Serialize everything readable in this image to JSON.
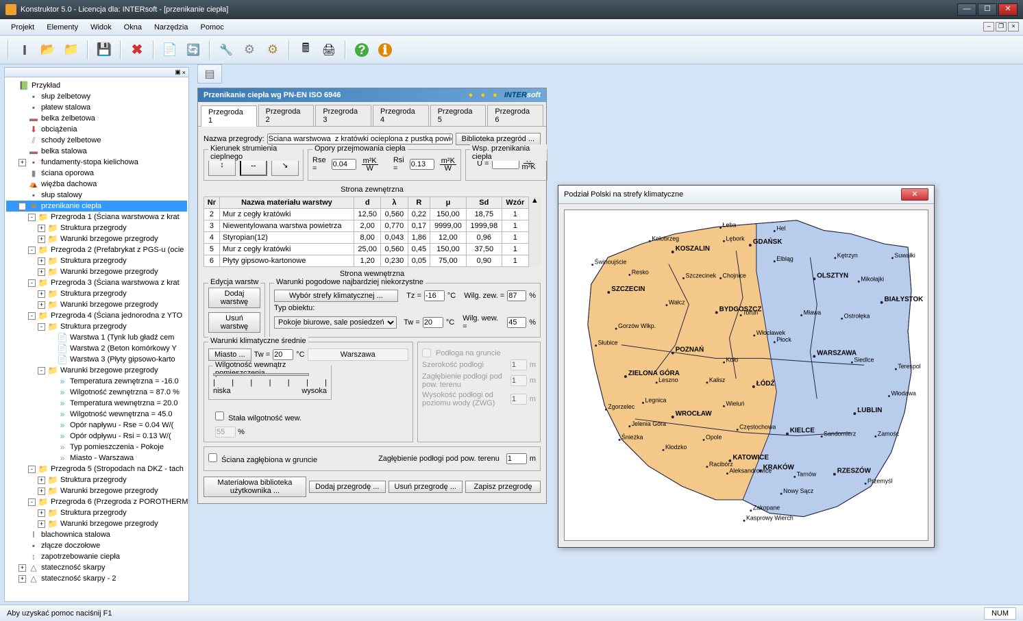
{
  "window": {
    "title": "Konstruktor 5.0 - Licencja dla: INTERsoft - [przenikanie ciepła]"
  },
  "menu": {
    "items": [
      "Projekt",
      "Elementy",
      "Widok",
      "Okna",
      "Narzędzia",
      "Pomoc"
    ]
  },
  "status": {
    "hint": "Aby uzyskać pomoc naciśnij F1",
    "num": "NUM"
  },
  "tree": {
    "root": "Przykład",
    "items": [
      {
        "l": 1,
        "ic": "item",
        "t": "słup żelbetowy"
      },
      {
        "l": 1,
        "ic": "item",
        "t": "płatew stalowa"
      },
      {
        "l": 1,
        "ic": "beam",
        "t": "belka żelbetowa"
      },
      {
        "l": 1,
        "ic": "load",
        "t": "obciążenia"
      },
      {
        "l": 1,
        "ic": "stair",
        "t": "schody żelbetowe"
      },
      {
        "l": 1,
        "ic": "beam",
        "t": "belka stalowa"
      },
      {
        "l": 1,
        "ic": "item",
        "t": "fundamenty-stopa kielichowa",
        "exp": "+"
      },
      {
        "l": 1,
        "ic": "wall",
        "t": "ściana oporowa"
      },
      {
        "l": 1,
        "ic": "roof",
        "t": "więźba dachowa"
      },
      {
        "l": 1,
        "ic": "item",
        "t": "słup stalowy"
      },
      {
        "l": 1,
        "ic": "heat",
        "t": "przenikanie ciepła",
        "exp": "-",
        "sel": true
      },
      {
        "l": 2,
        "ic": "fold",
        "t": "Przegroda 1 (Ściana warstwowa  z krat",
        "exp": "-"
      },
      {
        "l": 3,
        "ic": "struct",
        "t": "Struktura przegrody",
        "exp": "+"
      },
      {
        "l": 3,
        "ic": "struct",
        "t": "Warunki brzegowe przegrody",
        "exp": "+"
      },
      {
        "l": 2,
        "ic": "fold",
        "t": "Przegroda 2 (Prefabrykat z PGS-u (ocie",
        "exp": "-"
      },
      {
        "l": 3,
        "ic": "struct",
        "t": "Struktura przegrody",
        "exp": "+"
      },
      {
        "l": 3,
        "ic": "struct",
        "t": "Warunki brzegowe przegrody",
        "exp": "+"
      },
      {
        "l": 2,
        "ic": "fold",
        "t": "Przegroda 3 (Ściana warstwowa z krat",
        "exp": "-"
      },
      {
        "l": 3,
        "ic": "struct",
        "t": "Struktura przegrody",
        "exp": "+"
      },
      {
        "l": 3,
        "ic": "struct",
        "t": "Warunki brzegowe przegrody",
        "exp": "+"
      },
      {
        "l": 2,
        "ic": "fold",
        "t": "Przegroda 4 (Ściana jednorodna z YTO",
        "exp": "-"
      },
      {
        "l": 3,
        "ic": "fold",
        "t": "Struktura przegrody",
        "exp": "-"
      },
      {
        "l": 4,
        "ic": "layer",
        "t": "Warstwa 1 (Tynk lub gładź cem"
      },
      {
        "l": 4,
        "ic": "layer",
        "t": "Warstwa 2 (Beton komórkowy Y"
      },
      {
        "l": 4,
        "ic": "layer",
        "t": "Warstwa 3 (Płyty gipsowo-karto"
      },
      {
        "l": 3,
        "ic": "fold",
        "t": "Warunki brzegowe przegrody",
        "exp": "-"
      },
      {
        "l": 4,
        "ic": "val",
        "t": "Temperatura zewnętrzna = -16.0"
      },
      {
        "l": 4,
        "ic": "val",
        "t": "Wilgotność zewnętrzna = 87.0 %"
      },
      {
        "l": 4,
        "ic": "val",
        "t": "Temperatura wewnętrzna = 20.0"
      },
      {
        "l": 4,
        "ic": "val",
        "t": "Wilgotność wewnętrzna = 45.0"
      },
      {
        "l": 4,
        "ic": "val",
        "t": "Opór napływu - Rse = 0.04 W/("
      },
      {
        "l": 4,
        "ic": "val",
        "t": "Opór odpływu - Rsi = 0.13 W/("
      },
      {
        "l": 4,
        "ic": "txt",
        "t": "Typ pomieszczenia - Pokoje"
      },
      {
        "l": 4,
        "ic": "txt",
        "t": "Miasto - Warszawa"
      },
      {
        "l": 2,
        "ic": "fold",
        "t": "Przegroda 5 (Stropodach na DKZ - tach",
        "exp": "-"
      },
      {
        "l": 3,
        "ic": "struct",
        "t": "Struktura przegrody",
        "exp": "+"
      },
      {
        "l": 3,
        "ic": "struct",
        "t": "Warunki brzegowe przegrody",
        "exp": "+"
      },
      {
        "l": 2,
        "ic": "fold",
        "t": "Przegroda 6 (Przegroda z POROTHERM",
        "exp": "-"
      },
      {
        "l": 3,
        "ic": "struct",
        "t": "Struktura przegrody",
        "exp": "+"
      },
      {
        "l": 3,
        "ic": "struct",
        "t": "Warunki brzegowe przegrody",
        "exp": "+"
      },
      {
        "l": 1,
        "ic": "steel",
        "t": "blachownica stalowa"
      },
      {
        "l": 1,
        "ic": "item",
        "t": "złącze doczołowe"
      },
      {
        "l": 1,
        "ic": "demand",
        "t": "zapotrzebowanie ciepła"
      },
      {
        "l": 1,
        "ic": "slope",
        "t": "stateczność skarpy",
        "exp": "+"
      },
      {
        "l": 1,
        "ic": "slope",
        "t": "stateczność skarpy - 2",
        "exp": "+"
      }
    ]
  },
  "form": {
    "title": "Przenikanie ciepła wg PN-EN ISO 6946",
    "brand_a": "INTER",
    "brand_b": "soft",
    "tabs": [
      "Przegroda 1",
      "Przegroda 2",
      "Przegroda 3",
      "Przegroda 4",
      "Przegroda 5",
      "Przegroda 6"
    ],
    "name_label": "Nazwa przegrody:",
    "name_value": "Ściana warstwowa  z kratówki ocieplona z pustką powietrzną",
    "lib_btn": "Biblioteka przegród ...",
    "dir_label": "Kierunek strumienia cieplnego",
    "res_label": "Opory przejmowania ciepła",
    "coef_label": "Wsp. przenikania ciepła",
    "rse_label": "Rse =",
    "rse_val": "0.04",
    "rsi_label": "Rsi =",
    "rsi_val": "0.13",
    "u_label": "U =",
    "u_val": "",
    "unit_r_top": "m²K",
    "unit_r_bot": "W",
    "unit_u_top": "W",
    "unit_u_bot": "m²K",
    "outer_side": "Strona zewnętrzna",
    "inner_side": "Strona wewnętrzna",
    "table": {
      "headers": [
        "Nr",
        "Nazwa materiału warstwy",
        "d",
        "λ",
        "R",
        "μ",
        "Sd",
        "Wzór"
      ],
      "rows": [
        [
          "2",
          "Mur z cegły kratówki",
          "12,50",
          "0,560",
          "0,22",
          "150,00",
          "18,75",
          "1"
        ],
        [
          "3",
          "Niewentylowana warstwa powietrza",
          "2,00",
          "0,770",
          "0,17",
          "9999,00",
          "1999,98",
          "1"
        ],
        [
          "4",
          "Styropian(12)",
          "8,00",
          "0,043",
          "1,86",
          "12,00",
          "0,96",
          "1"
        ],
        [
          "5",
          "Mur z cegły kratówki",
          "25,00",
          "0,560",
          "0,45",
          "150,00",
          "37,50",
          "1"
        ],
        [
          "6",
          "Płyty gipsowo-kartonowe",
          "1,20",
          "0,230",
          "0,05",
          "75,00",
          "0,90",
          "1"
        ]
      ]
    },
    "edit_label": "Edycja warstw",
    "add_layer": "Dodaj warstwę",
    "del_layer": "Usuń warstwę",
    "weather_label": "Warunki pogodowe najbardziej niekorzystne",
    "zone_btn": "Wybór strefy klimatycznej ...",
    "obj_label": "Typ obiektu:",
    "obj_val": "Pokoje biurowe, sale posiedzeń",
    "tz_label": "Tz =",
    "tz_val": "-16",
    "temp_unit": "°C",
    "tw_label": "Tw =",
    "tw_val": "20",
    "hum_out_label": "Wilg. zew. =",
    "hum_out_val": "87",
    "pct": "%",
    "hum_in_label": "Wilg. wew. =",
    "hum_in_val": "45",
    "avg_label": "Warunki klimatyczne średnie",
    "city_btn": "Miasto ...",
    "tw_avg_label": "Tw =",
    "tw_avg_val": "20",
    "city_val": "Warszawa",
    "room_hum_label": "Wilgotność wewnątrz pomieszczenia",
    "low": "niska",
    "high": "wysoka",
    "const_hum": "Stała wilgotność wew.",
    "const_hum_val": "55",
    "floor_label": "Podłoga na gruncie",
    "floor_w": "Szerokość podłogi",
    "floor_w_val": "1",
    "floor_d": "Zagłębienie podłogi pod pow. terenu",
    "floor_d_val": "1",
    "floor_h": "Wysokość podłogi od poziomu wody (ZWG)",
    "floor_h_val": "1",
    "m": "m",
    "wall_ground": "Ściana zagłębiona w gruncie",
    "wall_ground_d": "Zagłębienie podłogi pod pow. terenu",
    "wall_ground_val": "1",
    "btn_lib": "Materiałowa biblioteka użytkownika ...",
    "btn_add": "Dodaj przegrodę ...",
    "btn_del": "Usuń przegrodę ...",
    "btn_save": "Zapisz przegrodę"
  },
  "map": {
    "title": "Podział Polski na strefy klimatyczne",
    "cities_big": [
      "GDAŃSK",
      "KOSZALIN",
      "SZCZECIN",
      "BYDGOSZCZ",
      "OLSZTYN",
      "BIAŁYSTOK",
      "POZNAŃ",
      "WARSZAWA",
      "ZIELONA GÓRA",
      "ŁÓDŹ",
      "WROCŁAW",
      "LUBLIN",
      "KIELCE",
      "KATOWICE",
      "KRAKÓW",
      "RZESZÓW"
    ],
    "cities": [
      "Łeba",
      "Hel",
      "Lębork",
      "Kołobrzeg",
      "Świnoujście",
      "Elbląg",
      "Kętrzyn",
      "Suwałki",
      "Resko",
      "Szczecinek",
      "Chojnice",
      "Mikołajki",
      "Wałcz",
      "Toruń",
      "Mława",
      "Ostrołęka",
      "Gorzów Wlkp.",
      "Słubice",
      "Włocławek",
      "Płock",
      "Leszno",
      "Koło",
      "Siedlce",
      "Terespol",
      "Legnica",
      "Kalisz",
      "Wieluń",
      "Włodawa",
      "Zgorzelec",
      "Jelenia Góra",
      "Śnieżka",
      "Częstochowa",
      "Opole",
      "Sandomierz",
      "Zamość",
      "Kłodzko",
      "Racibórz",
      "Aleksandrowice",
      "Tarnów",
      "Przemyśl",
      "Nowy Sącz",
      "Zakopane",
      "Kasprowy Wierch"
    ]
  }
}
